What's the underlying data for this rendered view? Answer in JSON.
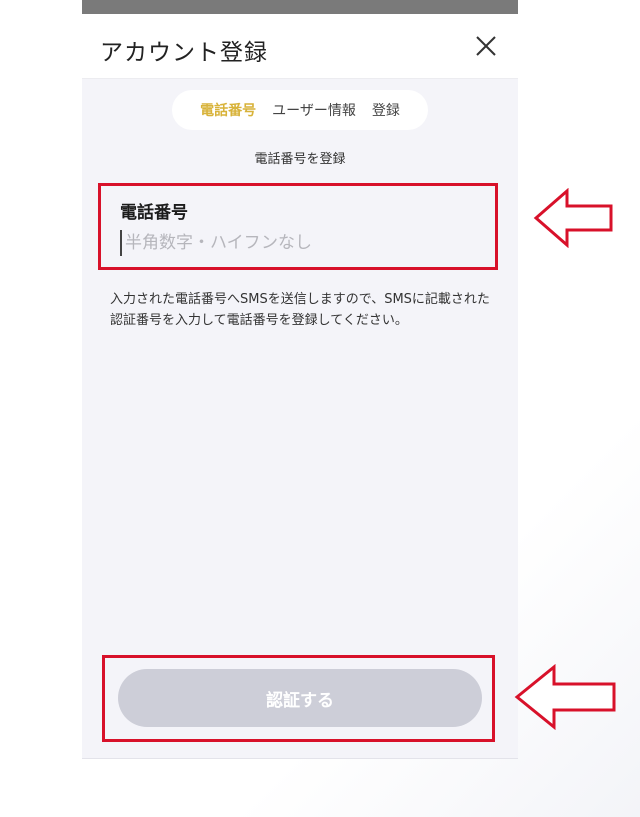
{
  "header": {
    "title": "アカウント登録"
  },
  "steps": [
    {
      "label": "電話番号",
      "active": true
    },
    {
      "label": "ユーザー情報",
      "active": false
    },
    {
      "label": "登録",
      "active": false
    }
  ],
  "subtitle": "電話番号を登録",
  "phone_field": {
    "label": "電話番号",
    "placeholder": "半角数字・ハイフンなし",
    "value": ""
  },
  "note": "入力された電話番号へSMSを送信しますので、SMSに記載された認証番号を入力して電話番号を登録してください。",
  "submit": {
    "label": "認証する",
    "disabled": true
  },
  "colors": {
    "accent": "#d8b33a",
    "annotation": "#d8112a",
    "button_disabled": "#cdced8",
    "background": "#f4f4f9"
  },
  "icons": {
    "close": "close-icon",
    "annotation_arrow": "left-arrow-icon"
  }
}
